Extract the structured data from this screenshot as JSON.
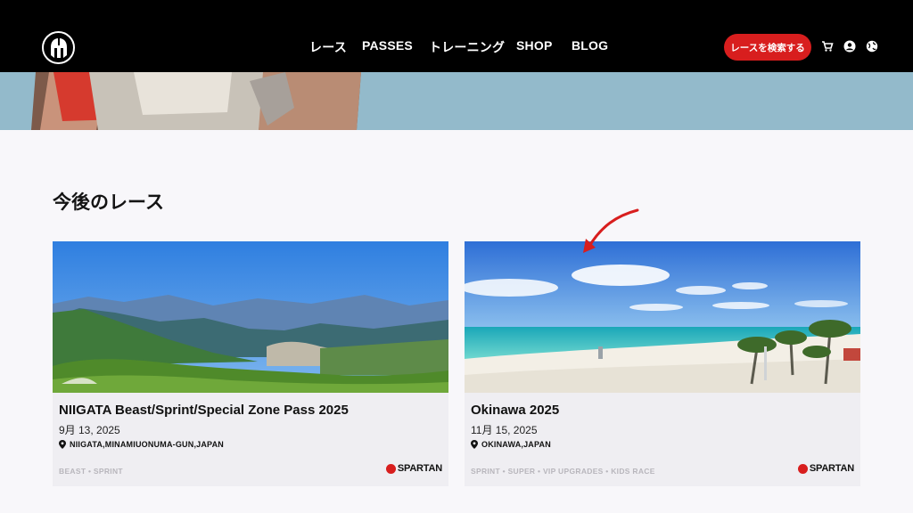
{
  "header": {
    "logo_label": "Spartan logo",
    "nav": [
      {
        "label": "レース"
      },
      {
        "label": "PASSES"
      },
      {
        "label": "トレーニング"
      },
      {
        "label": "SHOP"
      },
      {
        "label": "BLOG"
      }
    ],
    "search_button": "レースを検索する",
    "icons": [
      "cart-icon",
      "account-icon",
      "globe-icon"
    ]
  },
  "section": {
    "title": "今後のレース"
  },
  "races": [
    {
      "title": "NIIGATA Beast/Sprint/Special Zone Pass 2025",
      "date": "9月 13, 2025",
      "location": "NIIGATA,MINAMIUONUMA-GUN,JAPAN",
      "tags": "BEAST • SPRINT",
      "brand": "SPARTAN",
      "image": "mountain-landscape"
    },
    {
      "title": "Okinawa 2025",
      "date": "11月 15, 2025",
      "location": "OKINAWA,JAPAN",
      "tags": "SPRINT • SUPER • VIP UPGRADES • KIDS RACE",
      "brand": "SPARTAN",
      "image": "beach-landscape"
    }
  ],
  "colors": {
    "header_bg": "#000000",
    "accent": "#d81e1e",
    "page_bg": "#f8f7fa",
    "card_bg": "#efeef2"
  }
}
